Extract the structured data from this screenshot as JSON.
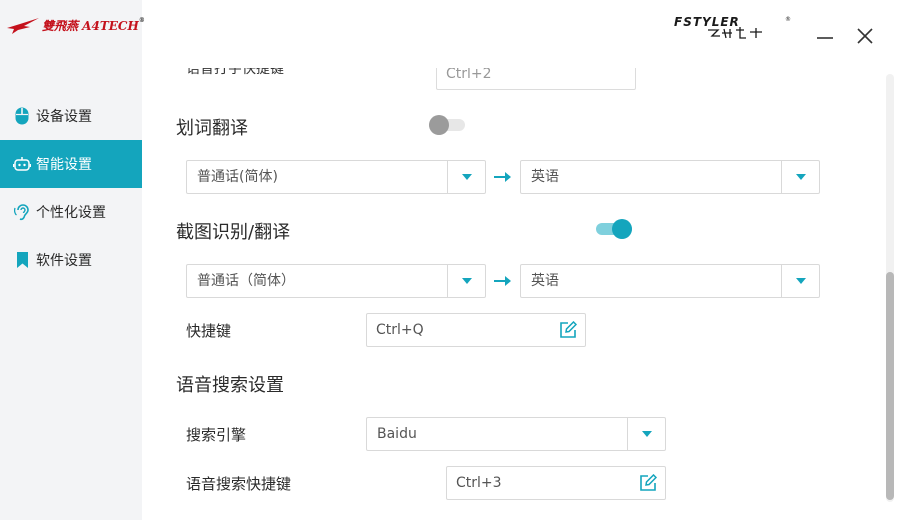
{
  "logo": {
    "text": "雙飛燕 A4TECH",
    "tm": "®"
  },
  "brand": {
    "name": "FSTYLER"
  },
  "sidebar": {
    "items": [
      {
        "label": "设备设置",
        "icon": "mouse-icon",
        "active": false
      },
      {
        "label": "智能设置",
        "icon": "robot-icon",
        "active": true
      },
      {
        "label": "个性化设置",
        "icon": "ear-icon",
        "active": false
      },
      {
        "label": "软件设置",
        "icon": "bookmark-icon",
        "active": false
      }
    ]
  },
  "content": {
    "cut_row": {
      "label": "语音打字快捷键",
      "value": "Ctrl+2"
    },
    "word_translate": {
      "title": "划词翻译",
      "enabled": false,
      "source": "普通话(简体)",
      "target": "英语"
    },
    "screenshot_translate": {
      "title": "截图识别/翻译",
      "enabled": true,
      "source": "普通话（简体）",
      "target": "英语",
      "shortcut_label": "快捷键",
      "shortcut_value": "Ctrl+Q"
    },
    "voice_search": {
      "title": "语音搜索设置",
      "engine_label": "搜索引擎",
      "engine_value": "Baidu",
      "shortcut_label": "语音搜索快捷键",
      "shortcut_value": "Ctrl+3"
    }
  },
  "colors": {
    "accent": "#14a5bd",
    "logo_red": "#c4111c",
    "sidebar_bg": "#f3f4f6"
  }
}
